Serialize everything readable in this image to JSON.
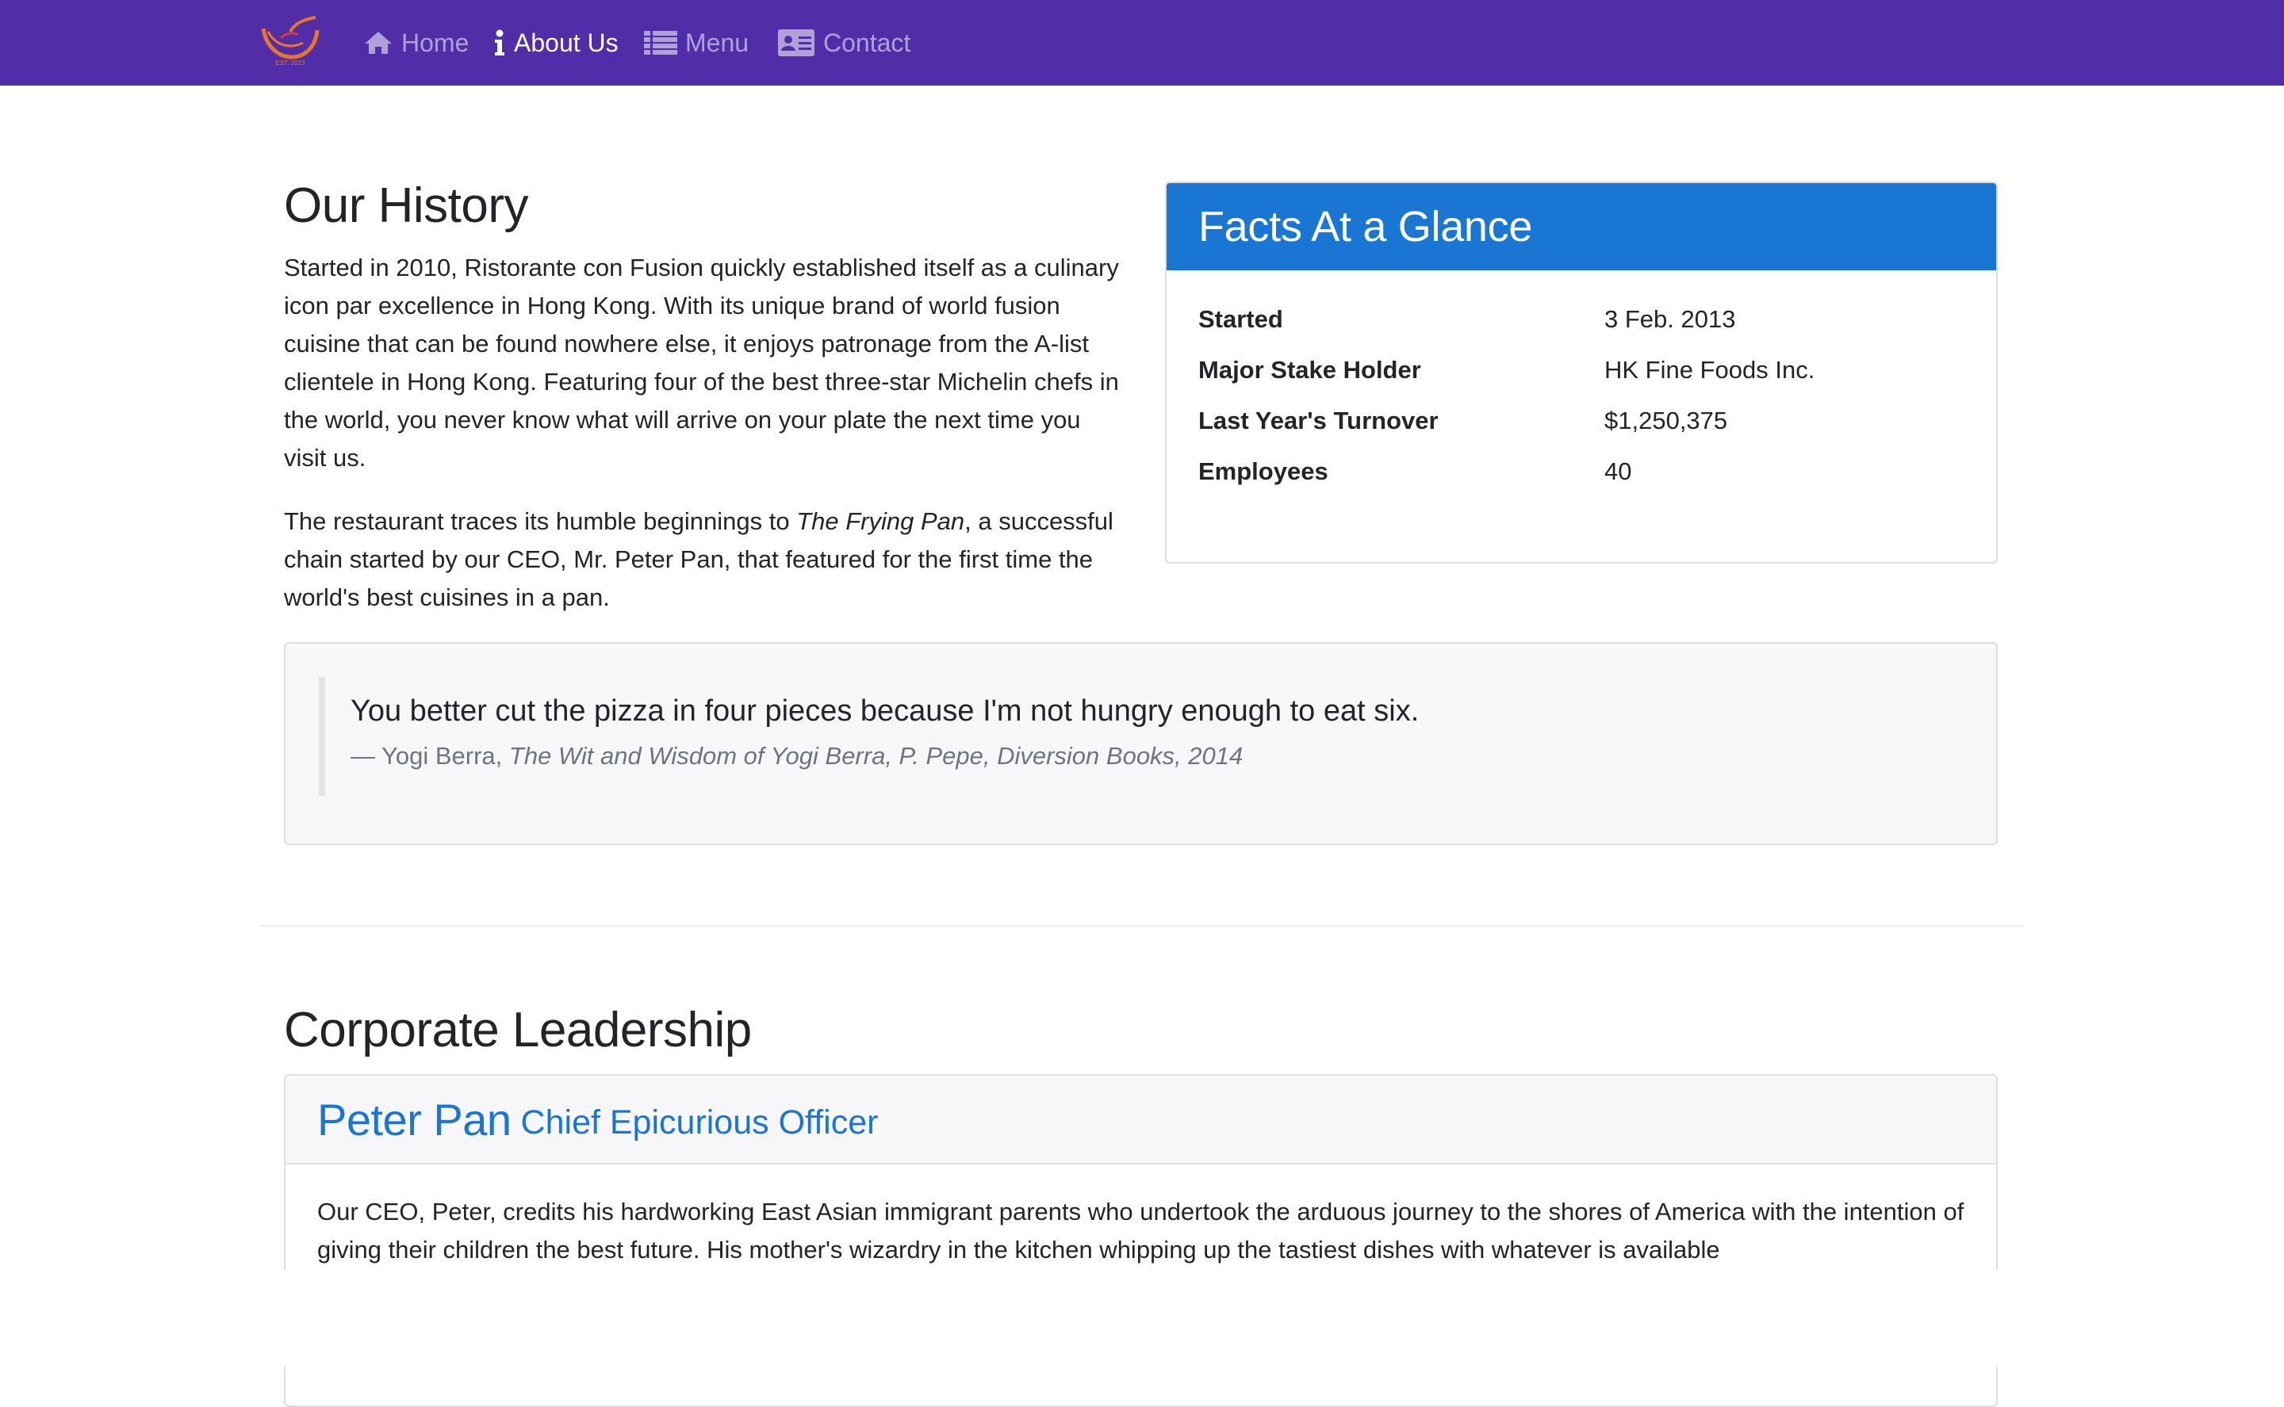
{
  "nav": {
    "items": [
      {
        "label": "Home",
        "icon": "home-icon",
        "active": false
      },
      {
        "label": "About Us",
        "icon": "info-icon",
        "active": true
      },
      {
        "label": "Menu",
        "icon": "list-icon",
        "active": false
      },
      {
        "label": "Contact",
        "icon": "address-card-icon",
        "active": false
      }
    ],
    "logo_text": "EST. 2013"
  },
  "history": {
    "title": "Our History",
    "paragraph1": "Started in 2010, Ristorante con Fusion quickly established itself as a culinary icon par excellence in Hong Kong. With its unique brand of world fusion cuisine that can be found nowhere else, it enjoys patronage from the A-list clientele in Hong Kong. Featuring four of the best three-star Michelin chefs in the world, you never know what will arrive on your plate the next time you visit us.",
    "paragraph2_before": "The restaurant traces its humble beginnings to ",
    "paragraph2_em": "The Frying Pan",
    "paragraph2_after": ", a successful chain started by our CEO, Mr. Peter Pan, that featured for the first time the world's best cuisines in a pan."
  },
  "facts": {
    "title": "Facts At a Glance",
    "rows": [
      {
        "key": "Started",
        "value": "3 Feb. 2013"
      },
      {
        "key": "Major Stake Holder",
        "value": "HK Fine Foods Inc."
      },
      {
        "key": "Last Year's Turnover",
        "value": "$1,250,375"
      },
      {
        "key": "Employees",
        "value": "40"
      }
    ]
  },
  "quote": {
    "text": "You better cut the pizza in four pieces because I'm not hungry enough to eat six.",
    "author": "— Yogi Berra, ",
    "source": "The Wit and Wisdom of Yogi Berra, P. Pepe, Diversion Books, 2014"
  },
  "leadership": {
    "title": "Corporate Leadership",
    "leader": {
      "name": "Peter Pan",
      "role": "Chief Epicurious Officer",
      "bio": "Our CEO, Peter, credits his hardworking East Asian immigrant parents who undertook the arduous journey to the shores of America with the intention of giving their children the best future. His mother's wizardry in the kitchen whipping up the tastiest dishes with whatever is available"
    }
  },
  "colors": {
    "navbar": "#512DA8",
    "facts_header": "#1976D2",
    "accent_text": "#1976D2",
    "logo_orange": "#E8772E"
  }
}
